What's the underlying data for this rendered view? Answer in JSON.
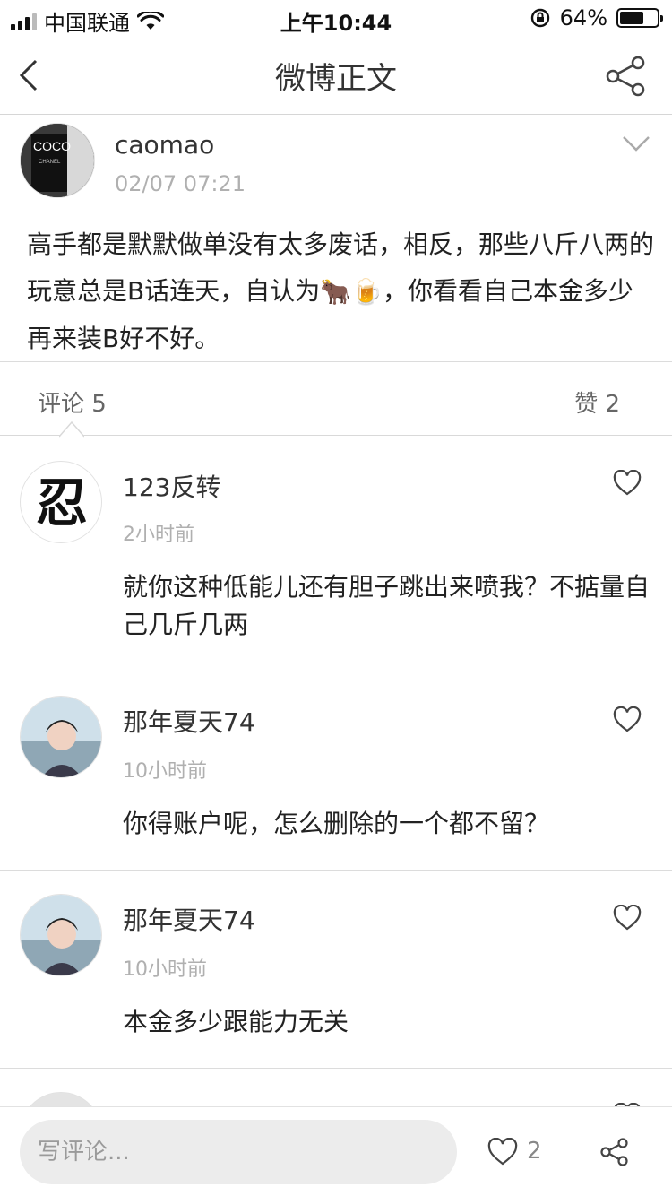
{
  "status_bar": {
    "carrier": "中国联通",
    "time": "上午10:44",
    "battery": "64%",
    "battery_level": 0.64
  },
  "nav": {
    "title": "微博正文",
    "back_icon": "chevron-left-icon",
    "share_icon": "share-icon"
  },
  "post": {
    "user": "caomao",
    "time": "02/07 07:21",
    "text_before_emoji": "高手都是默默做单没有太多废话，相反，那些八斤八两的玩意总是B话连天，自认为",
    "emoji_1": "🐂",
    "emoji_2": "🍺",
    "text_after_emoji": "，你看看自己本金多少再来装B好不好。"
  },
  "tabs": {
    "comments": "评论 5",
    "likes": "赞 2"
  },
  "comments": [
    {
      "user": "123反转",
      "time": "2小时前",
      "text": "就你这种低能儿还有胆子跳出来喷我？不掂量自己几斤几两",
      "avatar_glyph": "忍"
    },
    {
      "user": "那年夏天74",
      "time": "10小时前",
      "text": "你得账户呢，怎么删除的一个都不留？"
    },
    {
      "user": "那年夏天74",
      "time": "10小时前",
      "text": "本金多少跟能力无关"
    }
  ],
  "bottom_bar": {
    "placeholder": "写评论...",
    "like_count": "2"
  },
  "colors": {
    "divider": "#dcdcdc",
    "muted_text": "#b0b0b0",
    "input_bg": "#ececec"
  }
}
